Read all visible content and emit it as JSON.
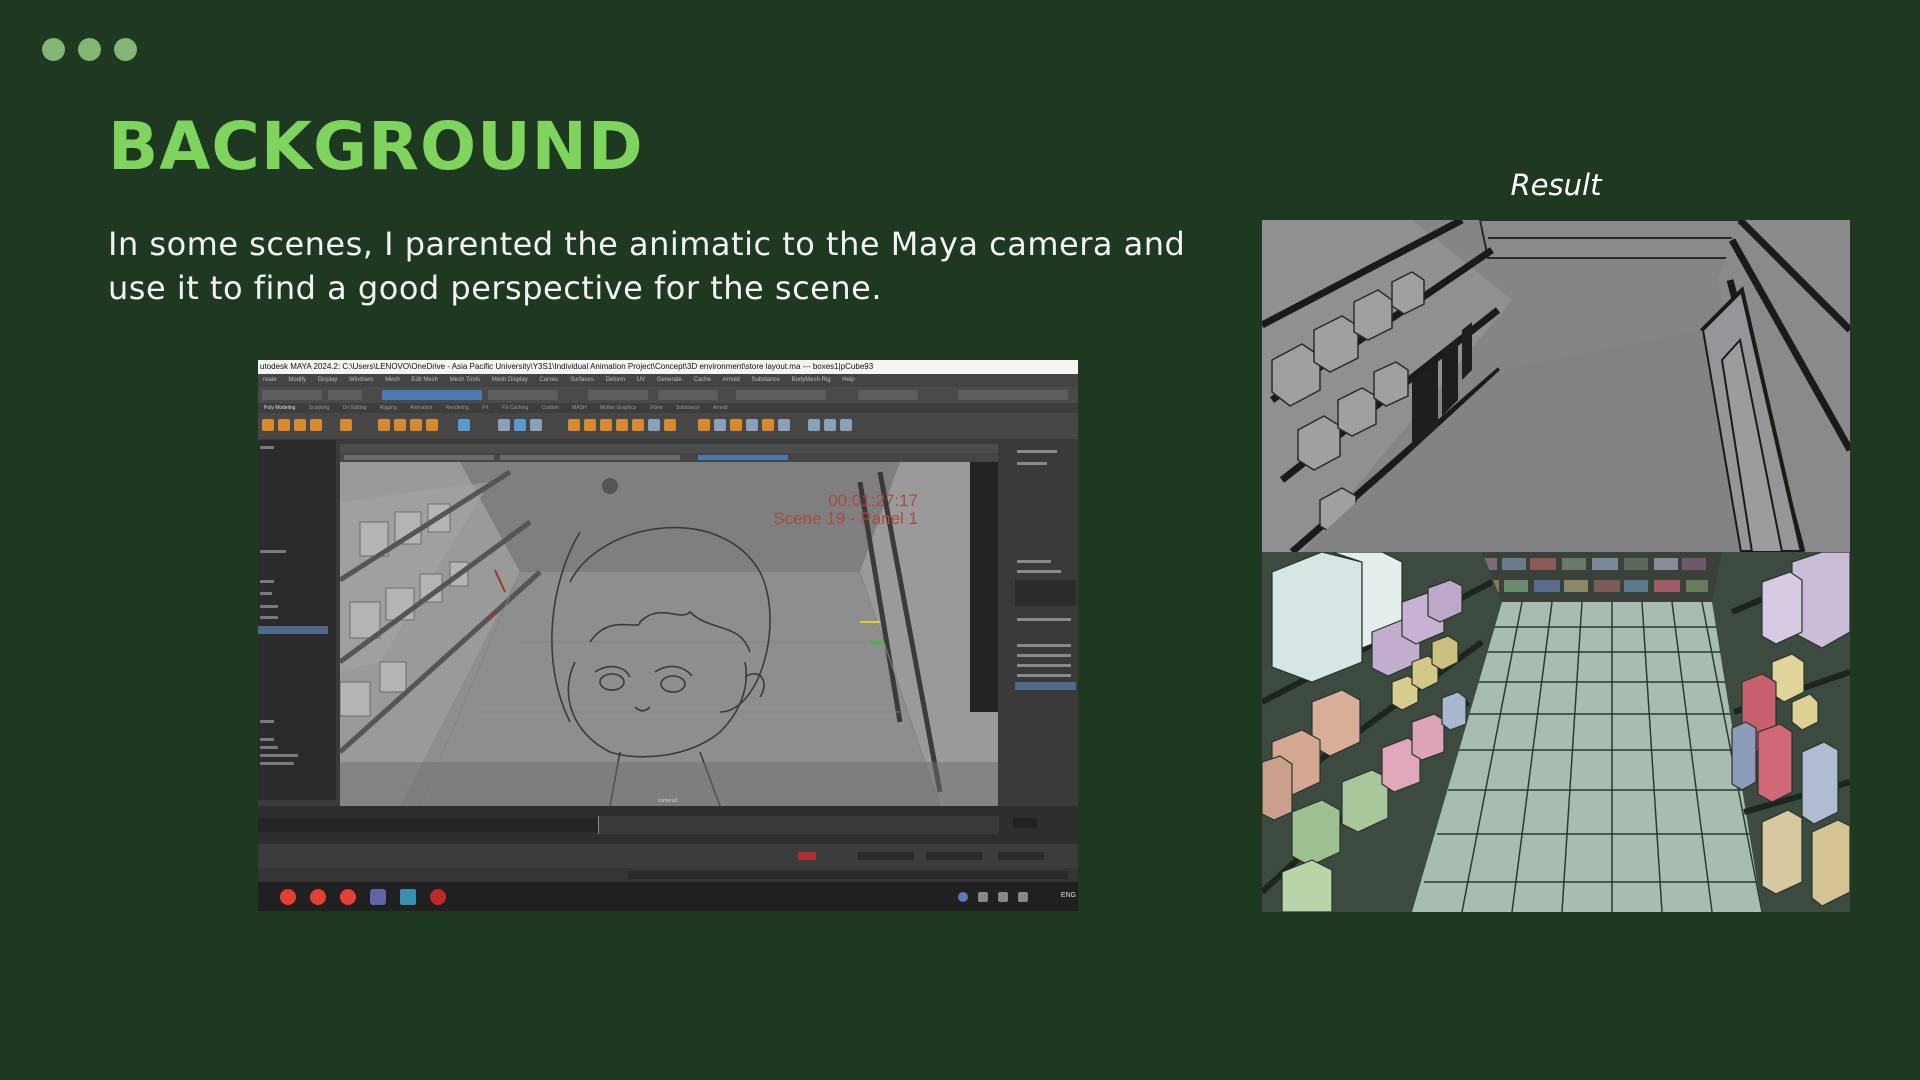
{
  "slide": {
    "title": "BACKGROUND",
    "body": "In some scenes, I parented the animatic to the Maya camera and use it to find a good perspective for the scene.",
    "result_label": "Result",
    "colors": {
      "background": "#1f3822",
      "title": "#7ed45c",
      "dots": "#83b574",
      "text": "#f2f2f2"
    }
  },
  "maya_screenshot": {
    "window_title": "utodesk MAYA 2024.2: C:\\Users\\LENOVO\\OneDrive - Asia Pacific University\\Y3S1\\Individual Animation Project\\Concept\\3D environment\\store layout.ma  ---  boxes1|pCube93",
    "menus": [
      "reate",
      "Modify",
      "Display",
      "Windows",
      "Mesh",
      "Edit Mesh",
      "Mesh Tools",
      "Mesh Display",
      "Curves",
      "Surfaces",
      "Deform",
      "UV",
      "Generate",
      "Cache",
      "Arnold",
      "Substance",
      "BodyMesh Rig",
      "Help"
    ],
    "shelf_tabs": [
      "Poly Modeling",
      "Sculpting",
      "UV Editing",
      "Rigging",
      "Animation",
      "Rendering",
      "FX",
      "FX Caching",
      "Custom",
      "MASH",
      "Motion Graphics",
      "XGen",
      "Substance",
      "Arnold"
    ],
    "viewport": {
      "timecode": "00:01:27:17",
      "scene_label": "Scene 19 - Panel 1",
      "camera": "camera3"
    },
    "taskbar_language": "ENG"
  }
}
